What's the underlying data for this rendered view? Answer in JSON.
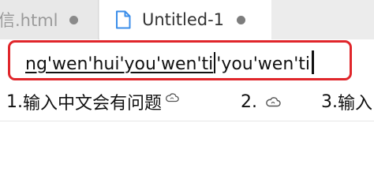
{
  "tabs": [
    {
      "label": "信.html",
      "active": false,
      "modified": true
    },
    {
      "label": "Untitled-1",
      "active": true,
      "modified": true
    }
  ],
  "ime": {
    "preedit_committed": "ng'wen'hui'you'wen'ti",
    "preedit_pending": "'you'wen'ti",
    "candidates": [
      {
        "index": "1.",
        "text": "输入中文会有问题",
        "icon": "cloud-icon"
      },
      {
        "index": "2.",
        "text": "",
        "icon": "cloud-icon"
      },
      {
        "index": "3.",
        "text": "输入"
      }
    ]
  },
  "colors": {
    "focus_border": "#e0262b",
    "tab_bar": "#ececec",
    "file_icon": "#3b8eea"
  }
}
